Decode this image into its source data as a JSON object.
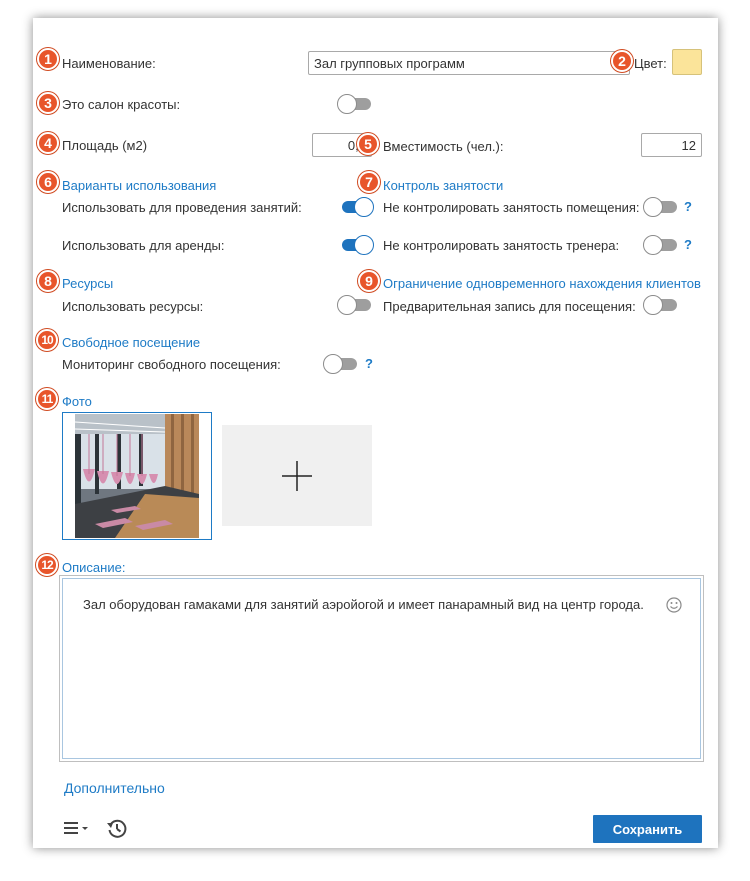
{
  "form": {
    "name_label": "Наименование:",
    "name_value": "Зал групповых программ",
    "color_label": "Цвет:",
    "color_value": "#fbe49a",
    "beauty_salon_label": "Это салон красоты:",
    "area_label": "Площадь (м2)",
    "area_value": "0,0",
    "capacity_label": "Вместимость (чел.):",
    "capacity_value": "12"
  },
  "usage": {
    "title": "Варианты использования",
    "classes_label": "Использовать для проведения занятий:",
    "rent_label": "Использовать для аренды:"
  },
  "occupancy": {
    "title": "Контроль занятости",
    "room_label": "Не контролировать занятость помещения:",
    "trainer_label": "Не контролировать занятость тренера:",
    "help": "?"
  },
  "resources": {
    "title": "Ресурсы",
    "use_label": "Использовать ресурсы:"
  },
  "clients_limit": {
    "title": "Ограничение одновременного нахождения клиентов",
    "prebook_label": "Предварительная запись для посещения:"
  },
  "free_visit": {
    "title": "Свободное посещение",
    "monitor_label": "Мониторинг свободного посещения:",
    "help": "?"
  },
  "photo": {
    "title": "Фото"
  },
  "description": {
    "title": "Описание:",
    "text": "Зал оборудован гамаками для занятий аэройогой и имеет панарамный вид на центр города."
  },
  "footer": {
    "more_link": "Дополнительно",
    "save_label": "Сохранить"
  },
  "toggles": {
    "beauty_salon": false,
    "use_for_classes": true,
    "use_for_rent": true,
    "no_room_control": false,
    "no_trainer_control": false,
    "use_resources": false,
    "prebooking": false,
    "free_visit_monitor": false
  },
  "badges": [
    "1",
    "2",
    "3",
    "4",
    "5",
    "6",
    "7",
    "8",
    "9",
    "10",
    "11",
    "12"
  ],
  "icons": {
    "menu": "menu-icon",
    "history": "history-icon",
    "emoji": "emoji-icon",
    "add": "plus-icon"
  }
}
